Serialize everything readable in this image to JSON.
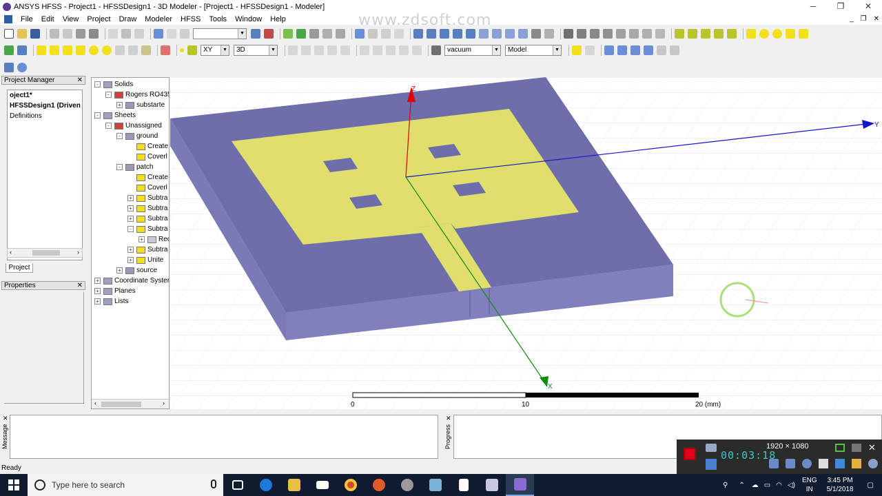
{
  "window": {
    "title": "ANSYS HFSS - Project1 - HFSSDesign1 - 3D Modeler - [Project1 - HFSSDesign1 - Modeler]",
    "minimize": "─",
    "restore": "❐",
    "close": "✕"
  },
  "menu": {
    "items": [
      "File",
      "Edit",
      "View",
      "Project",
      "Draw",
      "Modeler",
      "HFSS",
      "Tools",
      "Window",
      "Help"
    ],
    "mdi_min": "_",
    "mdi_restore": "❐",
    "mdi_close": "✕"
  },
  "watermark": "www.zdsoft.com",
  "toolbar": {
    "plane_select": "XY",
    "view_select": "3D",
    "material_select": "vacuum",
    "mode_select": "Model"
  },
  "project_manager": {
    "title": "Project Manager",
    "close": "✕",
    "items": [
      "oject1*",
      "HFSSDesign1 (Driven",
      "Definitions"
    ],
    "tab": "Project",
    "scroll_left": "‹",
    "scroll_right": "›"
  },
  "properties": {
    "title": "Properties",
    "close": "✕"
  },
  "tree": {
    "rows": [
      {
        "label": "Solids",
        "indent": 0,
        "exp": "-"
      },
      {
        "label": "Rogers RO435",
        "indent": 1,
        "exp": "-"
      },
      {
        "label": "substarte",
        "indent": 2,
        "exp": "+"
      },
      {
        "label": "Sheets",
        "indent": 0,
        "exp": "-"
      },
      {
        "label": "Unassigned",
        "indent": 1,
        "exp": "-"
      },
      {
        "label": "ground",
        "indent": 2,
        "exp": "-"
      },
      {
        "label": "Create",
        "indent": 3,
        "exp": ""
      },
      {
        "label": "Coverl",
        "indent": 3,
        "exp": ""
      },
      {
        "label": "patch",
        "indent": 2,
        "exp": "-"
      },
      {
        "label": "Create",
        "indent": 3,
        "exp": ""
      },
      {
        "label": "Coverl",
        "indent": 3,
        "exp": ""
      },
      {
        "label": "Subtra",
        "indent": 3,
        "exp": "+"
      },
      {
        "label": "Subtra",
        "indent": 3,
        "exp": "+"
      },
      {
        "label": "Subtra",
        "indent": 3,
        "exp": "+"
      },
      {
        "label": "Subtra",
        "indent": 3,
        "exp": "-"
      },
      {
        "label": "Rec",
        "indent": 4,
        "exp": "+"
      },
      {
        "label": "Subtra",
        "indent": 3,
        "exp": "+"
      },
      {
        "label": "Unite",
        "indent": 3,
        "exp": "+"
      },
      {
        "label": "source",
        "indent": 2,
        "exp": "+"
      },
      {
        "label": "Coordinate Syster",
        "indent": 0,
        "exp": "+"
      },
      {
        "label": "Planes",
        "indent": 0,
        "exp": "+"
      },
      {
        "label": "Lists",
        "indent": 0,
        "exp": "+"
      }
    ],
    "scroll_left": "‹",
    "scroll_right": "›"
  },
  "viewport": {
    "axis_z": "Z",
    "axis_x": "X",
    "axis_y": "Y",
    "scale_0": "0",
    "scale_10": "10",
    "scale_20": "20 (mm)",
    "colors": {
      "substrate_top": "#6e6eaa",
      "substrate_side": "#7a7ab6",
      "substrate_front": "#8080bd",
      "patch": "#e0df6e"
    }
  },
  "bottom": {
    "message_label": "Message",
    "progress_label": "Progress"
  },
  "status": "Ready",
  "recorder": {
    "resolution": "1920 × 1080",
    "timer": "00:03:18"
  },
  "taskbar": {
    "search_placeholder": "Type here to search",
    "lang_top": "ENG",
    "lang_bottom": "IN",
    "time": "3:45 PM",
    "date": "5/1/2018"
  }
}
